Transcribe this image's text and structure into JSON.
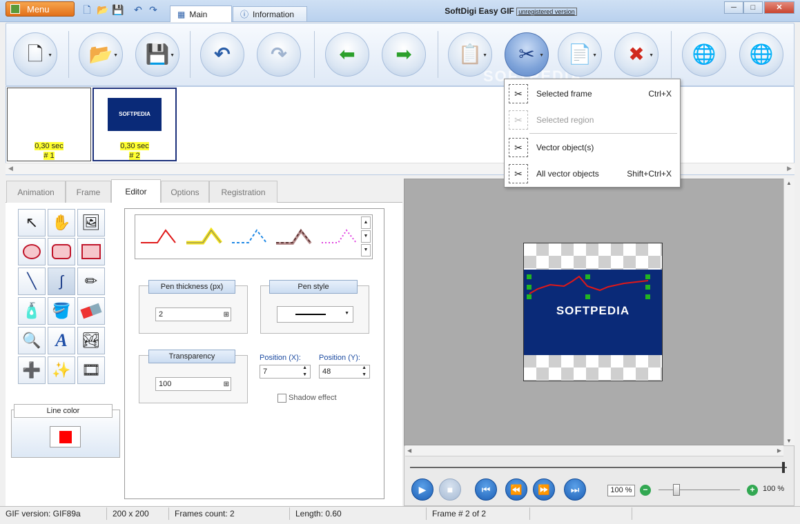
{
  "titlebar": {
    "menu_label": "Menu",
    "tabs": [
      {
        "label": "Main"
      },
      {
        "label": "Information"
      }
    ],
    "app_title": "SoftDigi Easy GIF",
    "unregistered": "unregistered version",
    "min": "─",
    "max": "□",
    "close": "✕"
  },
  "ribbon": {
    "buttons": [
      {
        "icon": "new-file-icon",
        "glyph": "🗋"
      },
      {
        "icon": "open-folder-icon",
        "glyph": "📂"
      },
      {
        "icon": "save-icon",
        "glyph": "💾"
      },
      {
        "icon": "undo-icon",
        "glyph": "↶"
      },
      {
        "icon": "redo-icon",
        "glyph": "↷"
      },
      {
        "icon": "previous-frame-icon",
        "glyph": "⬅"
      },
      {
        "icon": "next-frame-icon",
        "glyph": "➡"
      },
      {
        "icon": "paste-icon",
        "glyph": "📋"
      },
      {
        "icon": "cut-icon",
        "glyph": "✂"
      },
      {
        "icon": "copy-icon",
        "glyph": "📄"
      },
      {
        "icon": "delete-icon",
        "glyph": "✖"
      },
      {
        "icon": "web-preview-icon",
        "glyph": "🌐"
      },
      {
        "icon": "upload-web-icon",
        "glyph": "🌐"
      }
    ],
    "watermark": "SOFTPEDIA"
  },
  "frames": [
    {
      "time": "0,30 sec",
      "num": "# 1"
    },
    {
      "time": "0,30 sec",
      "num": "# 2",
      "thumb_text": "SOFTPEDIA"
    }
  ],
  "left_tabs": [
    "Animation",
    "Frame",
    "Editor",
    "Options",
    "Registration"
  ],
  "editor": {
    "pen_thickness_label": "Pen thickness (px)",
    "pen_thickness_value": "2",
    "pen_style_label": "Pen style",
    "transparency_label": "Transparency",
    "transparency_value": "100",
    "pos_x_label": "Position (X):",
    "pos_x_value": "7",
    "pos_y_label": "Position (Y):",
    "pos_y_value": "48",
    "shadow_label": "Shadow effect",
    "line_color_label": "Line color",
    "line_color": "#ff0000"
  },
  "canvas": {
    "image_text": "SOFTPEDIA",
    "bg_color": "#0a2a78"
  },
  "player": {
    "zoom_box": "100 %",
    "zoom_label": "100 %"
  },
  "context_menu": [
    {
      "label": "Selected frame",
      "shortcut": "Ctrl+X",
      "enabled": true,
      "icon": "cut-frame-icon"
    },
    {
      "label": "Selected region",
      "shortcut": "",
      "enabled": false,
      "icon": "cut-region-icon"
    },
    {
      "label": "Vector object(s)",
      "shortcut": "",
      "enabled": true,
      "icon": "cut-vector-icon"
    },
    {
      "label": "All vector objects",
      "shortcut": "Shift+Ctrl+X",
      "enabled": true,
      "icon": "cut-all-vectors-icon"
    }
  ],
  "status": [
    "GIF version: GIF89a",
    "200 x 200",
    "Frames count: 2",
    "Length: 0.60",
    "Frame # 2 of 2"
  ]
}
